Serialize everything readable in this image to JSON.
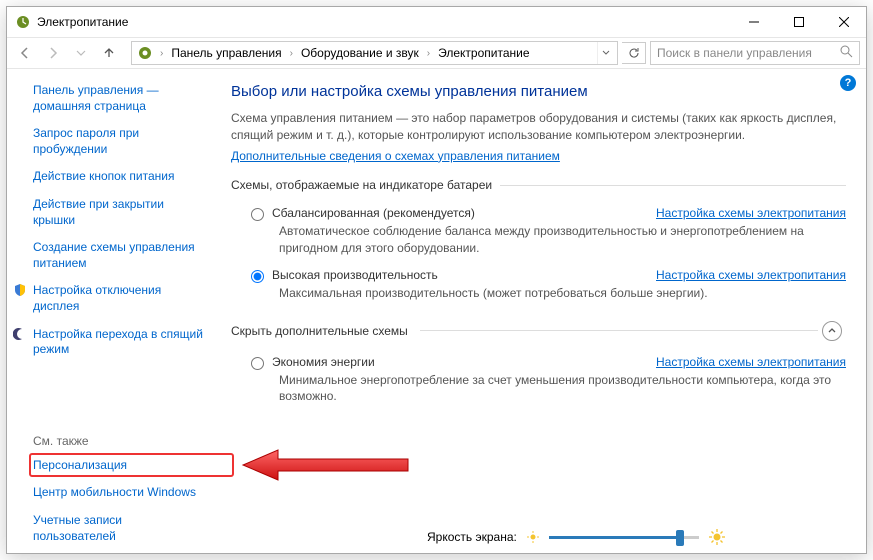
{
  "window": {
    "title": "Электропитание"
  },
  "breadcrumb": {
    "segments": [
      "Панель управления",
      "Оборудование и звук",
      "Электропитание"
    ]
  },
  "search": {
    "placeholder": "Поиск в панели управления"
  },
  "sidebar": {
    "items": [
      {
        "label": "Панель управления — домашняя страница"
      },
      {
        "label": "Запрос пароля при пробуждении"
      },
      {
        "label": "Действие кнопок питания"
      },
      {
        "label": "Действие при закрытии крышки"
      },
      {
        "label": "Создание схемы управления питанием"
      },
      {
        "label": "Настройка отключения дисплея"
      },
      {
        "label": "Настройка перехода в спящий режим"
      }
    ],
    "see_also_label": "См. также",
    "see_also": [
      {
        "label": "Персонализация"
      },
      {
        "label": "Центр мобильности Windows"
      },
      {
        "label": "Учетные записи пользователей"
      }
    ]
  },
  "main": {
    "heading": "Выбор или настройка схемы управления питанием",
    "description": "Схема управления питанием — это набор параметров оборудования и системы (таких как яркость дисплея, спящий режим и т. д.), которые контролируют использование компьютером электроэнергии.",
    "more_link": "Дополнительные сведения о схемах управления питанием",
    "battery_group_label": "Схемы, отображаемые на индикаторе батареи",
    "configure_label": "Настройка схемы электропитания",
    "hide_extra_label": "Скрыть дополнительные схемы",
    "plans": [
      {
        "name": "Сбалансированная (рекомендуется)",
        "desc": "Автоматическое соблюдение баланса между производительностью и энергопотреблением на пригодном для этого оборудовании.",
        "checked": false
      },
      {
        "name": "Высокая производительность",
        "desc": "Максимальная производительность (может потребоваться больше энергии).",
        "checked": true
      }
    ],
    "extra_plans": [
      {
        "name": "Экономия энергии",
        "desc": "Минимальное энергопотребление за счет уменьшения производительности компьютера, когда это возможно."
      }
    ],
    "brightness_label": "Яркость экрана:"
  }
}
